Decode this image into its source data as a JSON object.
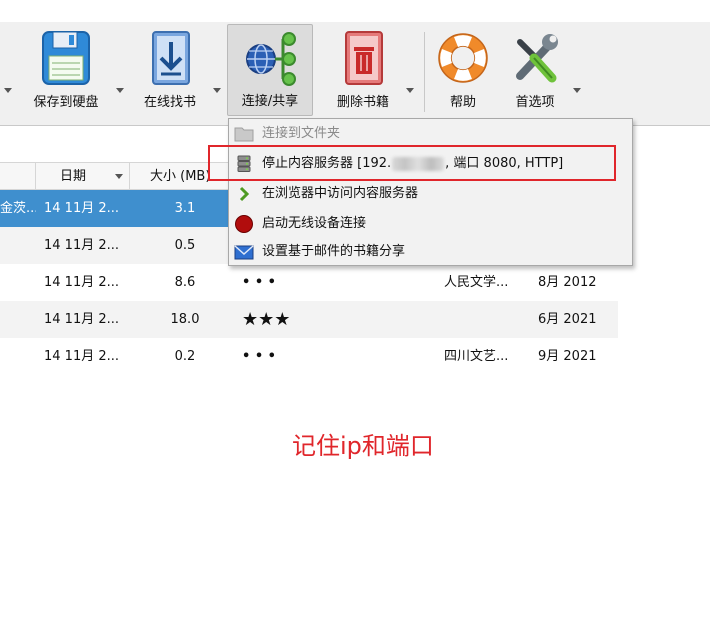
{
  "toolbar": {
    "buttons": [
      {
        "label": "保存到硬盘",
        "icon": "floppy-disk-icon"
      },
      {
        "label": "在线找书",
        "icon": "download-book-icon"
      },
      {
        "label": "连接/共享",
        "icon": "globe-network-icon"
      },
      {
        "label": "删除书籍",
        "icon": "trash-book-icon"
      },
      {
        "label": "帮助",
        "icon": "lifebuoy-icon"
      },
      {
        "label": "首选项",
        "icon": "tools-icon"
      }
    ]
  },
  "table": {
    "columns": {
      "date": "日期",
      "size": "大小 (MB)"
    },
    "rows": [
      {
        "title": "金茨...",
        "date": "14 11月 2...",
        "size": "3.1",
        "rating": "",
        "publisher": "",
        "pubdate": ""
      },
      {
        "title": "",
        "date": "14 11月 2...",
        "size": "0.5",
        "rating": "",
        "publisher": "",
        "pubdate": ""
      },
      {
        "title": "",
        "date": "14 11月 2...",
        "size": "8.6",
        "rating": "• • •",
        "publisher": "人民文学...",
        "pubdate": "8月 2012"
      },
      {
        "title": "",
        "date": "14 11月 2...",
        "size": "18.0",
        "rating": "★★★",
        "publisher": "",
        "pubdate": "6月 2021"
      },
      {
        "title": "",
        "date": "14 11月 2...",
        "size": "0.2",
        "rating": "• • •",
        "publisher": "四川文艺...",
        "pubdate": "9月 2021"
      }
    ]
  },
  "menu": {
    "items": [
      {
        "label": "连接到文件夹",
        "icon": "folder-icon",
        "disabled": true
      },
      {
        "label_prefix": "停止内容服务器 [192.",
        "label_suffix": ", 端口 8080, HTTP]",
        "icon": "server-icon"
      },
      {
        "label": "在浏览器中访问内容服务器",
        "icon": "chevron-right-icon"
      },
      {
        "label": "启动无线设备连接",
        "icon": "red-dot-icon"
      },
      {
        "label": "设置基于邮件的书籍分享",
        "icon": "email-icon"
      }
    ]
  },
  "annotation": {
    "text": "记住ip和端口",
    "color": "#e0262b"
  }
}
